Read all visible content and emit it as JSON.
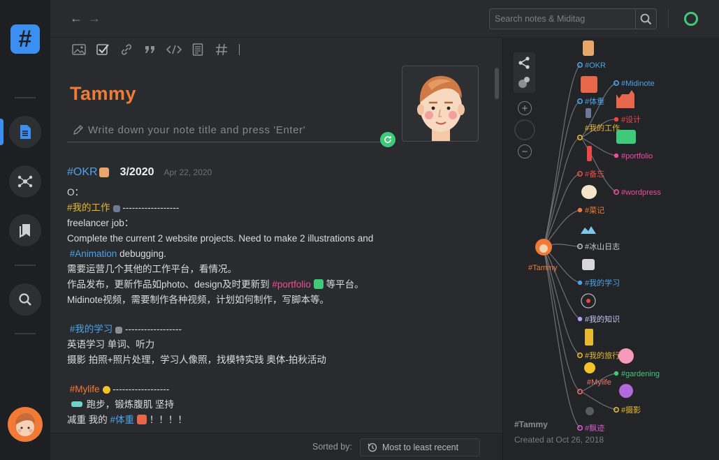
{
  "search": {
    "placeholder": "Search notes & Miditag"
  },
  "toolbar": {
    "tools": [
      "image-icon",
      "checkbox-icon",
      "link-icon",
      "quote-icon",
      "code-icon",
      "document-icon",
      "hashtag-icon"
    ]
  },
  "note": {
    "title": "Tammy",
    "title_input_placeholder": "Write down your note title and press 'Enter'",
    "head": {
      "tag": "#OKR",
      "date": "3/2020",
      "sub": "Apr 22, 2020"
    },
    "lines": [
      {
        "text": "O："
      },
      {
        "tag": "#我的工作",
        "rest": " ------------------"
      },
      {
        "text": "freelancer job："
      },
      {
        "text": "Complete the current 2 website projects.  Need to make 2 illustrations and"
      },
      {
        "tag": "#Animation",
        "rest": " debugging."
      },
      {
        "text": "需要运营几个其他的工作平台，看情况。"
      },
      {
        "pre": "作品发布，更新作品如photo、design及时更新到 ",
        "tag": "#portfolio",
        "rest": " 等平台。"
      },
      {
        "text": "Midinote视频，需要制作各种视频，计划如何制作，写脚本等。"
      },
      {
        "tag": "#我的学习",
        "rest": " ------------------"
      },
      {
        "text": "英语学习 单词、听力"
      },
      {
        "text": "摄影  拍照+照片处理，学习人像照，找模特实践   奥体-拍秋活动"
      },
      {
        "tag": "#Mylife",
        "rest": " ------------------"
      },
      {
        "text": "跑步，锻炼腹肌     坚持"
      },
      {
        "pre": "减重 我的 ",
        "tag": "#体重",
        "rest": " ！！！！"
      }
    ]
  },
  "footer": {
    "sorted_label": "Sorted by:",
    "sort_value": "Most to least recent"
  },
  "mindmap": {
    "root": "#Tammy",
    "nodes": [
      "#OKR",
      "#体重",
      "#我的工作",
      "#备忘",
      "#菜记",
      "#冰山日志",
      "#我的学习",
      "#我的知识",
      "#我的旅行",
      "#Mylife",
      "#飘迹"
    ],
    "subnodes": [
      "#Midinote",
      "#设计",
      "#portfolio",
      "#wordpress",
      "#gardening",
      "#摄影"
    ],
    "name": "#Tammy",
    "created": "Created at Oct 26, 2018"
  },
  "colors": {
    "accent": "#3b8ff0",
    "orange": "#f07a36",
    "green": "#3fc97b",
    "pink": "#ef4d9a",
    "yellow": "#e8b92a"
  }
}
